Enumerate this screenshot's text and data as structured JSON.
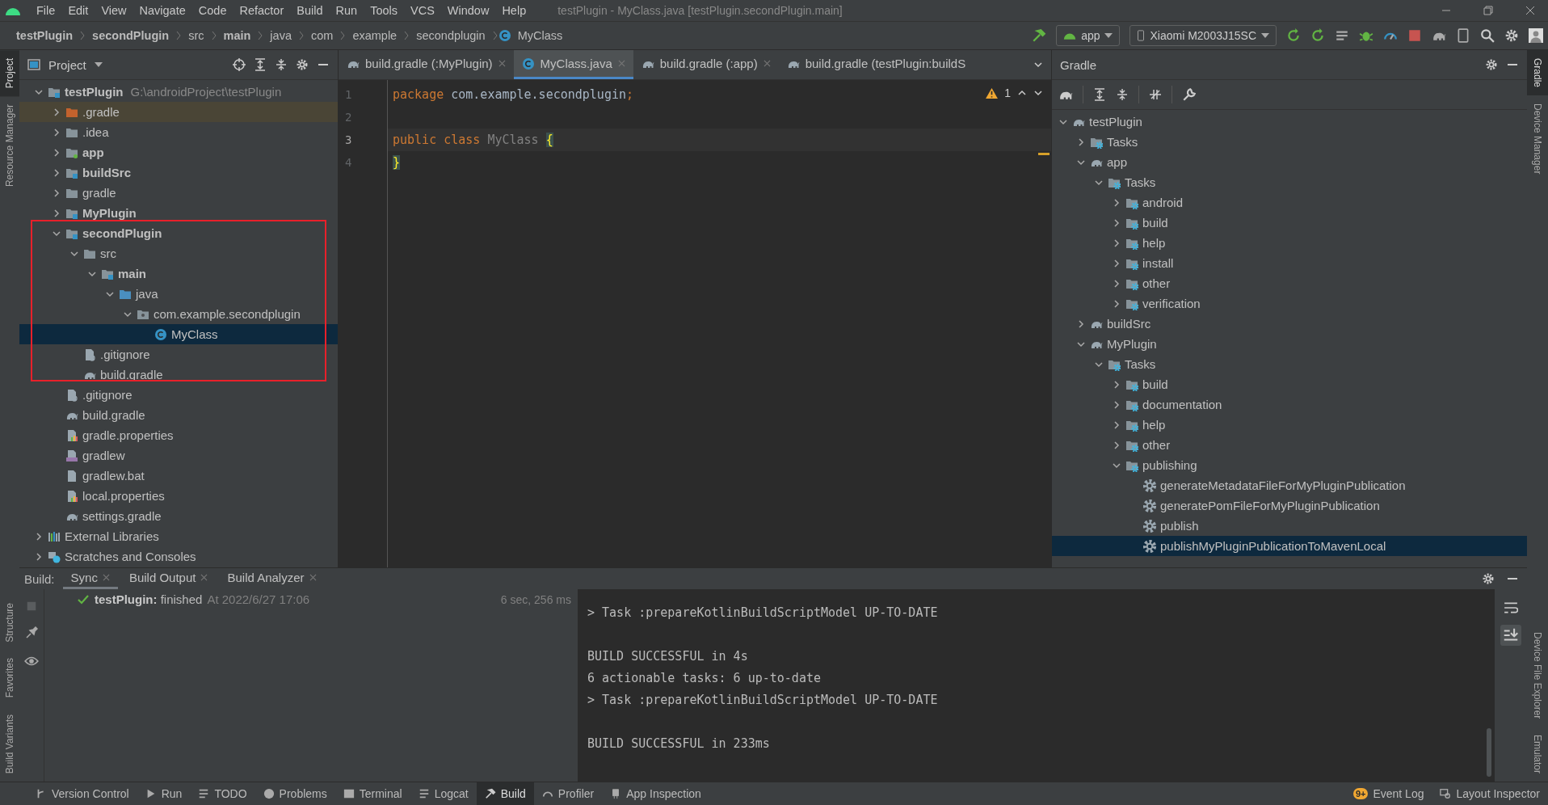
{
  "menu": [
    "File",
    "Edit",
    "View",
    "Navigate",
    "Code",
    "Refactor",
    "Build",
    "Run",
    "Tools",
    "VCS",
    "Window",
    "Help"
  ],
  "window_title": "testPlugin - MyClass.java [testPlugin.secondPlugin.main]",
  "breadcrumbs": [
    {
      "label": "testPlugin",
      "kind": "bold"
    },
    {
      "label": "secondPlugin",
      "kind": "bold"
    },
    {
      "label": "src",
      "kind": "plain"
    },
    {
      "label": "main",
      "kind": "bold"
    },
    {
      "label": "java",
      "kind": "plain"
    },
    {
      "label": "com",
      "kind": "plain"
    },
    {
      "label": "example",
      "kind": "plain"
    },
    {
      "label": "secondplugin",
      "kind": "plain"
    },
    {
      "label": "MyClass",
      "kind": "class"
    }
  ],
  "run_config": "app",
  "device": "Xiaomi M2003J15SC",
  "left_strip": {
    "top": [
      {
        "label": "Project",
        "selected": true
      },
      {
        "label": "Resource Manager",
        "selected": false
      }
    ],
    "bottom": [
      {
        "label": "Structure",
        "selected": false
      },
      {
        "label": "Favorites",
        "selected": false
      },
      {
        "label": "Build Variants",
        "selected": false
      }
    ]
  },
  "right_strip": {
    "top": [
      {
        "label": "Gradle",
        "selected": true
      },
      {
        "label": "Device Manager",
        "selected": false
      }
    ],
    "bottom": [
      {
        "label": "Device File Explorer",
        "selected": false
      },
      {
        "label": "Emulator",
        "selected": false
      }
    ]
  },
  "project": {
    "title": "Project",
    "tree": [
      {
        "label": "testPlugin",
        "kind": "module",
        "path": "G:\\androidProject\\testPlugin",
        "expanded": true,
        "selected": false,
        "children": [
          {
            "label": ".gradle",
            "kind": "excluded",
            "expanded": false,
            "selected": false
          },
          {
            "label": ".idea",
            "kind": "folder",
            "expanded": false,
            "selected": false
          },
          {
            "label": "app",
            "kind": "android-module",
            "expanded": false,
            "selected": false
          },
          {
            "label": "buildSrc",
            "kind": "module",
            "expanded": false,
            "selected": false
          },
          {
            "label": "gradle",
            "kind": "folder",
            "expanded": false,
            "selected": false
          },
          {
            "label": "MyPlugin",
            "kind": "module",
            "expanded": false,
            "selected": false
          },
          {
            "label": "secondPlugin",
            "kind": "module",
            "expanded": true,
            "selected": false,
            "children": [
              {
                "label": "src",
                "kind": "folder",
                "expanded": true,
                "selected": false,
                "children": [
                  {
                    "label": "main",
                    "kind": "module",
                    "expanded": true,
                    "selected": false,
                    "children": [
                      {
                        "label": "java",
                        "kind": "source",
                        "expanded": true,
                        "selected": false,
                        "children": [
                          {
                            "label": "com.example.secondplugin",
                            "kind": "package",
                            "expanded": true,
                            "selected": false,
                            "children": [
                              {
                                "label": "MyClass",
                                "kind": "class",
                                "selected": true
                              }
                            ]
                          }
                        ]
                      }
                    ]
                  }
                ]
              },
              {
                "label": ".gitignore",
                "kind": "gitignore",
                "selected": false
              },
              {
                "label": "build.gradle",
                "kind": "gradle",
                "selected": false
              }
            ]
          },
          {
            "label": ".gitignore",
            "kind": "gitignore",
            "selected": false
          },
          {
            "label": "build.gradle",
            "kind": "gradle",
            "selected": false
          },
          {
            "label": "gradle.properties",
            "kind": "properties",
            "selected": false
          },
          {
            "label": "gradlew",
            "kind": "script",
            "selected": false
          },
          {
            "label": "gradlew.bat",
            "kind": "file",
            "selected": false
          },
          {
            "label": "local.properties",
            "kind": "properties",
            "selected": false
          },
          {
            "label": "settings.gradle",
            "kind": "gradle",
            "selected": false
          }
        ]
      },
      {
        "label": "External Libraries",
        "kind": "libraries",
        "expanded": false,
        "selected": false
      },
      {
        "label": "Scratches and Consoles",
        "kind": "scratches",
        "expanded": false,
        "selected": false
      }
    ]
  },
  "editor": {
    "tabs": [
      {
        "label": "build.gradle (:MyPlugin)",
        "kind": "gradle",
        "selected": false
      },
      {
        "label": "MyClass.java",
        "kind": "class",
        "selected": true
      },
      {
        "label": "build.gradle (:app)",
        "kind": "gradle",
        "selected": false
      },
      {
        "label": "build.gradle (testPlugin:buildS",
        "kind": "gradle",
        "selected": false
      }
    ],
    "warnings": "1",
    "lines": [
      {
        "number": "1",
        "current": false,
        "tokens": [
          {
            "text": "package",
            "kind": "keyword"
          },
          {
            "text": " com.example.secondplugin",
            "kind": "plain"
          },
          {
            "text": ";",
            "kind": "keyword"
          }
        ]
      },
      {
        "number": "2",
        "current": false
      },
      {
        "number": "3",
        "current": true,
        "tokens": [
          {
            "text": "public",
            "kind": "keyword"
          },
          {
            "text": " class",
            "kind": "keyword"
          },
          {
            "text": " MyClass",
            "kind": "unused"
          },
          {
            "text": " {",
            "kind": "brace"
          }
        ]
      },
      {
        "number": "4",
        "current": false,
        "tokens": [
          {
            "text": "}",
            "kind": "brace"
          }
        ]
      }
    ]
  },
  "gradle": {
    "title": "Gradle",
    "tree": [
      {
        "label": "testPlugin",
        "kind": "project",
        "expanded": true,
        "selected": false,
        "children": [
          {
            "label": "Tasks",
            "kind": "tasks",
            "expanded": false,
            "selected": false
          },
          {
            "label": "app",
            "kind": "project",
            "expanded": true,
            "selected": false,
            "children": [
              {
                "label": "Tasks",
                "kind": "tasks",
                "expanded": true,
                "selected": false,
                "children": [
                  {
                    "label": "android",
                    "kind": "tasks",
                    "expanded": false,
                    "selected": false
                  },
                  {
                    "label": "build",
                    "kind": "tasks",
                    "expanded": false,
                    "selected": false
                  },
                  {
                    "label": "help",
                    "kind": "tasks",
                    "expanded": false,
                    "selected": false
                  },
                  {
                    "label": "install",
                    "kind": "tasks",
                    "expanded": false,
                    "selected": false
                  },
                  {
                    "label": "other",
                    "kind": "tasks",
                    "expanded": false,
                    "selected": false
                  },
                  {
                    "label": "verification",
                    "kind": "tasks",
                    "expanded": false,
                    "selected": false
                  }
                ]
              }
            ]
          },
          {
            "label": "buildSrc",
            "kind": "project",
            "expanded": false,
            "selected": false
          },
          {
            "label": "MyPlugin",
            "kind": "project",
            "expanded": true,
            "selected": false,
            "children": [
              {
                "label": "Tasks",
                "kind": "tasks",
                "expanded": true,
                "selected": false,
                "children": [
                  {
                    "label": "build",
                    "kind": "tasks",
                    "expanded": false,
                    "selected": false
                  },
                  {
                    "label": "documentation",
                    "kind": "tasks",
                    "expanded": false,
                    "selected": false
                  },
                  {
                    "label": "help",
                    "kind": "tasks",
                    "expanded": false,
                    "selected": false
                  },
                  {
                    "label": "other",
                    "kind": "tasks",
                    "expanded": false,
                    "selected": false
                  },
                  {
                    "label": "publishing",
                    "kind": "tasks",
                    "expanded": true,
                    "selected": false,
                    "children": [
                      {
                        "label": "generateMetadataFileForMyPluginPublication",
                        "kind": "task",
                        "selected": false
                      },
                      {
                        "label": "generatePomFileForMyPluginPublication",
                        "kind": "task",
                        "selected": false
                      },
                      {
                        "label": "publish",
                        "kind": "task",
                        "selected": false
                      },
                      {
                        "label": "publishMyPluginPublicationToMavenLocal",
                        "kind": "task",
                        "selected": true
                      }
                    ]
                  }
                ]
              }
            ]
          }
        ]
      }
    ]
  },
  "build_panel": {
    "label": "Build:",
    "tabs": [
      {
        "label": "Sync",
        "selected": true
      },
      {
        "label": "Build Output",
        "selected": false
      },
      {
        "label": "Build Analyzer",
        "selected": false
      }
    ],
    "sync": {
      "status": "**testPlugin:** finished",
      "time": "At 2022/6/27 17:06",
      "duration": "6 sec, 256 ms"
    },
    "console": [
      [
        "> Task :prepareKotlinBuildScriptModel UP-TO-DATE"
      ],
      [
        "BUILD SUCCESSFUL in 4s",
        "6 actionable tasks: 6 up-to-date",
        "> Task :prepareKotlinBuildScriptModel UP-TO-DATE"
      ],
      [
        "BUILD SUCCESSFUL in 233ms"
      ]
    ]
  },
  "status_bar": {
    "left": [
      {
        "label": "Version Control",
        "selected": false
      },
      {
        "label": "Run",
        "selected": false
      },
      {
        "label": "TODO",
        "selected": false
      },
      {
        "label": "Problems",
        "selected": false
      },
      {
        "label": "Terminal",
        "selected": false
      },
      {
        "label": "Logcat",
        "selected": false
      },
      {
        "label": "Build",
        "selected": true
      },
      {
        "label": "Profiler",
        "selected": false
      },
      {
        "label": "App Inspection",
        "selected": false
      }
    ],
    "right": [
      {
        "label": "Event Log",
        "badge": "9+"
      },
      {
        "label": "Layout Inspector"
      }
    ]
  }
}
